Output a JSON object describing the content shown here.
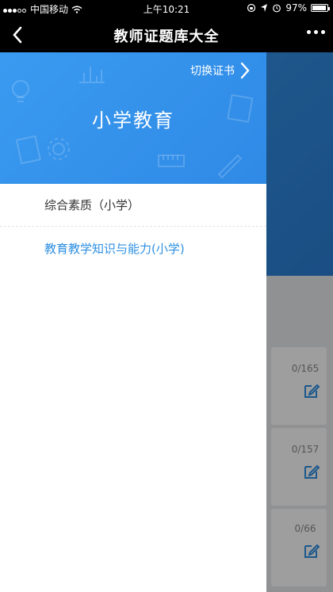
{
  "status_bar": {
    "carrier": "中国移动",
    "time": "上午10:21",
    "battery": "97%",
    "battery_level": 0.97
  },
  "nav": {
    "title": "教师证题库大全",
    "back_icon": "chevron-left-icon",
    "more_icon": "more-dots-icon"
  },
  "drawer": {
    "switch_label": "切换证书",
    "cert_title": "小学教育",
    "items": [
      {
        "label": "综合素质（小学）",
        "active": false
      },
      {
        "label": "教育教学知识与能力(小学)",
        "active": true
      }
    ]
  },
  "background_cards": [
    {
      "count": "0/165"
    },
    {
      "count": "0/157"
    },
    {
      "count": "0/66"
    }
  ],
  "colors": {
    "accent": "#2e8fe2",
    "header_blue": "#3a9af0",
    "nav_bg": "#000000"
  }
}
